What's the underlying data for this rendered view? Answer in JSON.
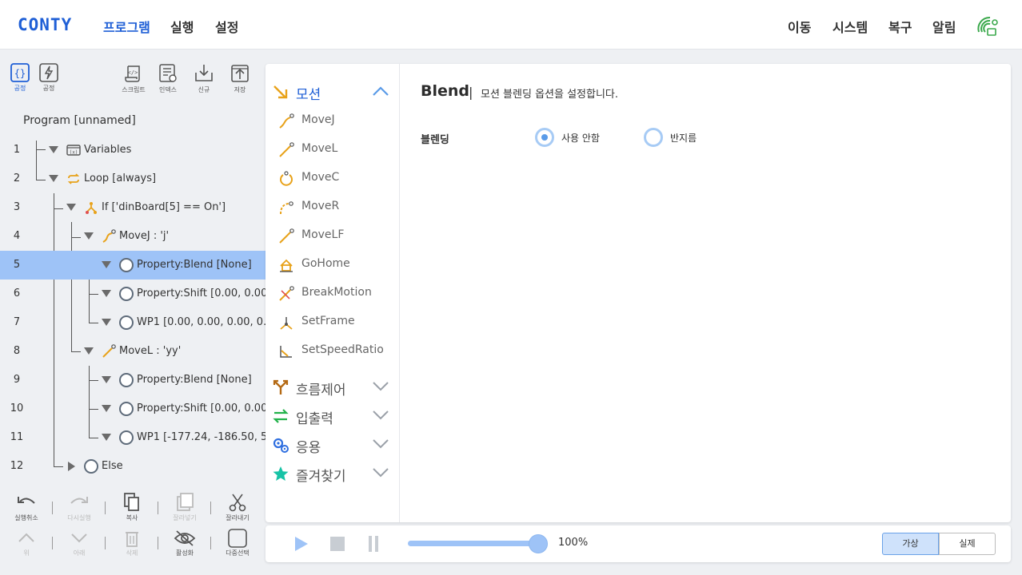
{
  "header": {
    "logo": "CONTY",
    "nav": [
      "프로그램",
      "실행",
      "설정"
    ],
    "right_nav": [
      "이동",
      "시스템",
      "복구",
      "알림"
    ],
    "accent": "#1f5fd6"
  },
  "left_toolbar": {
    "mode_buttons": [
      "공정",
      "공정"
    ],
    "actions": [
      "스크립트",
      "인덱스",
      "신규",
      "저장"
    ]
  },
  "program": {
    "title": "Program [unnamed]",
    "rows": [
      {
        "num": "1",
        "text": "Variables",
        "icon": "variables-icon"
      },
      {
        "num": "2",
        "text": "Loop [always]",
        "icon": "loop-icon"
      },
      {
        "num": "3",
        "text": "If ['dinBoard[5] == On']",
        "icon": "if-icon"
      },
      {
        "num": "4",
        "text": "MoveJ : 'j'",
        "icon": "movej-icon"
      },
      {
        "num": "5",
        "text": "Property:Blend [None]",
        "icon": "ring-icon",
        "selected": true
      },
      {
        "num": "6",
        "text": "Property:Shift [0.00, 0.00,",
        "icon": "ring-icon"
      },
      {
        "num": "7",
        "text": "WP1 [0.00, 0.00, 0.00, 0.0",
        "icon": "ring-icon"
      },
      {
        "num": "8",
        "text": "MoveL : 'yy'",
        "icon": "movel-icon"
      },
      {
        "num": "9",
        "text": "Property:Blend [None]",
        "icon": "ring-icon"
      },
      {
        "num": "10",
        "text": "Property:Shift [0.00, 0.00,",
        "icon": "ring-icon"
      },
      {
        "num": "11",
        "text": "WP1 [-177.24, -186.50, 5",
        "icon": "ring-icon"
      },
      {
        "num": "12",
        "text": "Else",
        "icon": "ring-icon"
      }
    ]
  },
  "bottom_toolbar": {
    "row1": [
      "실행취소",
      "다시실행",
      "복사",
      "잘라넣기",
      "잘라내기"
    ],
    "row2": [
      "위",
      "아래",
      "삭제",
      "활성화",
      "다중선택"
    ]
  },
  "palette": {
    "motion_category": "모션",
    "motion_items": [
      "MoveJ",
      "MoveL",
      "MoveC",
      "MoveR",
      "MoveLF",
      "GoHome",
      "BreakMotion",
      "SetFrame",
      "SetSpeedRatio"
    ],
    "other_categories": [
      "흐름제어",
      "입출력",
      "응용",
      "즐겨찾기"
    ]
  },
  "detail": {
    "title": "Blend",
    "separator": "|",
    "description": "모션 블렌딩 옵션을 설정합니다.",
    "blend_label": "블렌딩",
    "options": [
      "사용 안함",
      "반지름"
    ],
    "selected_option": "사용 안함"
  },
  "playbar": {
    "speed_percent": 100,
    "speed_text": "100%",
    "modes": [
      "가상",
      "실제"
    ],
    "active_mode": "가상"
  }
}
